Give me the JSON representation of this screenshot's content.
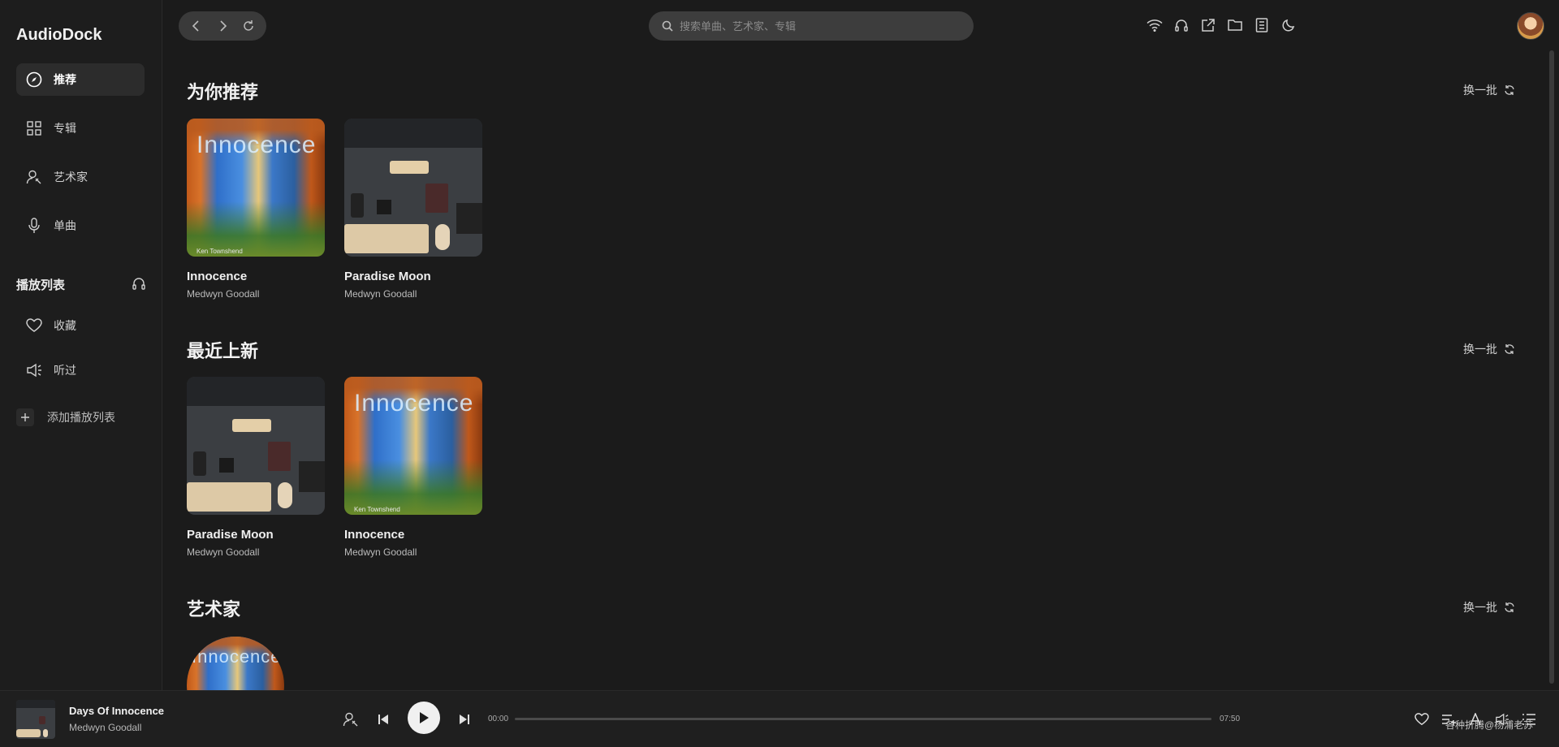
{
  "app": {
    "title": "AudioDock"
  },
  "sidebar": {
    "nav": [
      {
        "label": "推荐",
        "icon": "compass-icon"
      },
      {
        "label": "专辑",
        "icon": "grid-icon"
      },
      {
        "label": "艺术家",
        "icon": "artist-icon"
      },
      {
        "label": "单曲",
        "icon": "microphone-icon"
      }
    ],
    "playlist_section": {
      "title": "播放列表",
      "icon": "headphones-icon"
    },
    "playlists": [
      {
        "label": "收藏",
        "icon": "heart-icon"
      },
      {
        "label": "听过",
        "icon": "speaker-icon"
      }
    ],
    "add_playlist_label": "添加播放列表"
  },
  "topbar": {
    "search_placeholder": "搜索单曲、艺术家、专辑",
    "icons": [
      "wifi-icon",
      "headphones-icon",
      "external-link-icon",
      "folder-icon",
      "list-icon",
      "moon-icon"
    ]
  },
  "sections": {
    "recommend": {
      "title": "为你推荐",
      "refresh_label": "换一批",
      "cards": [
        {
          "title": "Innocence",
          "artist": "Medwyn Goodall",
          "art_word": "Innocence",
          "art_credit": "Ken Townshend"
        },
        {
          "title": "Paradise Moon",
          "artist": "Medwyn Goodall"
        }
      ]
    },
    "new": {
      "title": "最近上新",
      "refresh_label": "换一批",
      "cards": [
        {
          "title": "Paradise Moon",
          "artist": "Medwyn Goodall"
        },
        {
          "title": "Innocence",
          "artist": "Medwyn Goodall",
          "art_word": "Innocence",
          "art_credit": "Ken Townshend"
        }
      ]
    },
    "artists": {
      "title": "艺术家",
      "refresh_label": "换一批",
      "art_word": "Innocence"
    }
  },
  "player": {
    "track_title": "Days Of Innocence",
    "track_artist": "Medwyn Goodall",
    "time_current": "00:00",
    "time_total": "07:50",
    "progress": 0,
    "watermark": "各种折腾@杨浦老苏"
  },
  "colors": {
    "background": "#1b1b1b",
    "accent": "#f0f0f0"
  }
}
